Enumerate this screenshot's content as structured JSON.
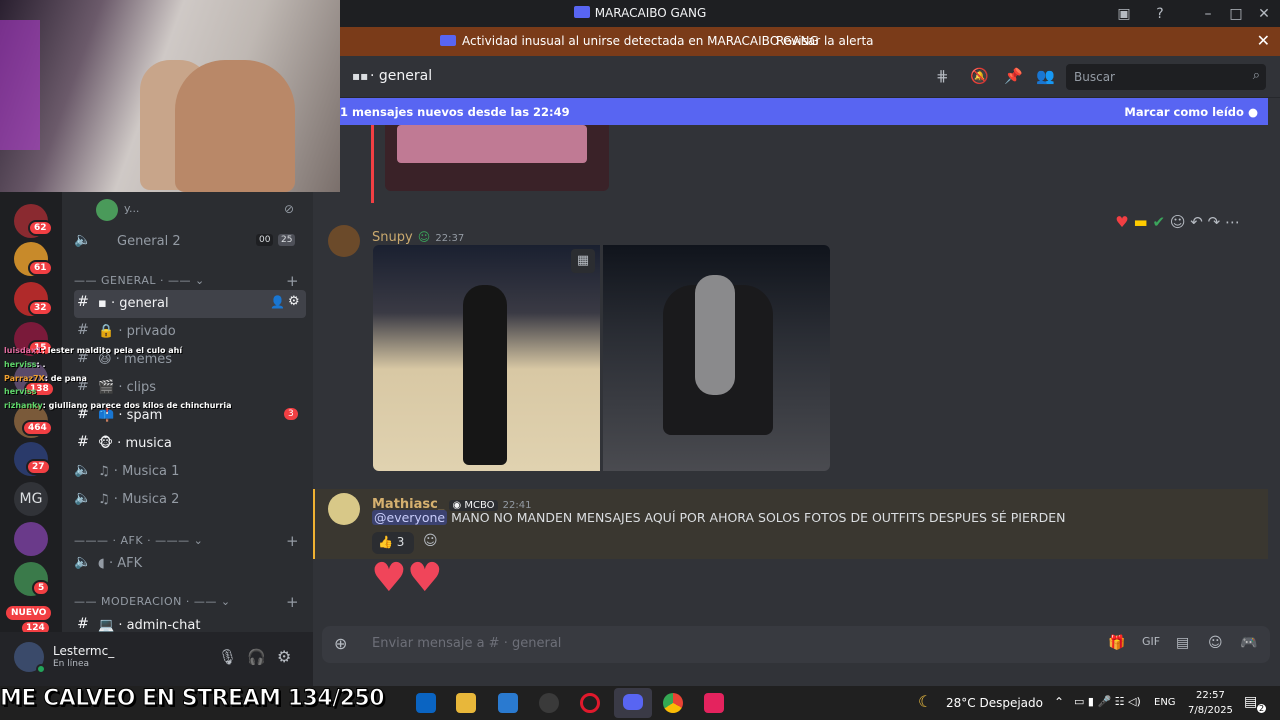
{
  "window": {
    "title": "MARACAIBO GANG"
  },
  "alert": {
    "text": "Actividad inusual al unirse detectada en MARACAIBO GANG",
    "action": "Revisar la alerta"
  },
  "header": {
    "channel": "general",
    "search_placeholder": "Buscar"
  },
  "newbar": {
    "text": "1 mensajes nuevos desde las 22:49",
    "action": "Marcar como leído"
  },
  "rail_badges": [
    "62",
    "61",
    "32",
    "15",
    "138",
    "464",
    "27",
    "5",
    "124"
  ],
  "rail_mg": "MG",
  "rail_new": "NUEVO",
  "sidebar": {
    "voice_user": "y...",
    "general2": {
      "label": "General 2",
      "count1": "00",
      "count2": "25"
    },
    "cat_general": "GENERAL",
    "channels": [
      {
        "label": "general",
        "active": true
      },
      {
        "label": "privado"
      },
      {
        "label": "memes"
      },
      {
        "label": "clips"
      },
      {
        "label": "spam",
        "badge": "3"
      },
      {
        "label": "musica"
      },
      {
        "label": "Musica 1"
      },
      {
        "label": "Musica 2"
      }
    ],
    "cat_afk": "AFK",
    "afk": "AFK",
    "cat_moderacion": "MODERACION",
    "admin": "admin-chat"
  },
  "user": {
    "name": "Lestermc_",
    "status": "En línea"
  },
  "stream_chat": [
    {
      "name": "luisdax1",
      "text": "lester maldito pela el culo ahí"
    },
    {
      "name": "herviss",
      "text": "."
    },
    {
      "name": "Parraz7X",
      "text": "de pana"
    },
    {
      "name": "herviss",
      "text": ""
    },
    {
      "name": "rizhanky",
      "text": "giulliano parece dos kilos de chinchurria"
    }
  ],
  "messages": [
    {
      "author": "Snupy",
      "time": "22:37"
    },
    {
      "author": "Mathiasc_",
      "tag": "MCBO",
      "time": "22:41",
      "mention": "@everyone",
      "text": "MANO NO MANDEN MENSAJES AQUÍ POR AHORA SOLOS FOTOS DE OUTFITS DESPUES SÉ PIERDEN",
      "reaction_count": "3"
    }
  ],
  "input": {
    "placeholder": "Enviar mensaje a # ",
    "channel": "general"
  },
  "taskbar": {
    "weather": "28°C  Despejado",
    "lang": "ENG",
    "time": "22:57",
    "date": "7/8/2025",
    "notif": "2"
  },
  "overlay": {
    "text": "ME CALVEO EN STREAM 134/250"
  }
}
